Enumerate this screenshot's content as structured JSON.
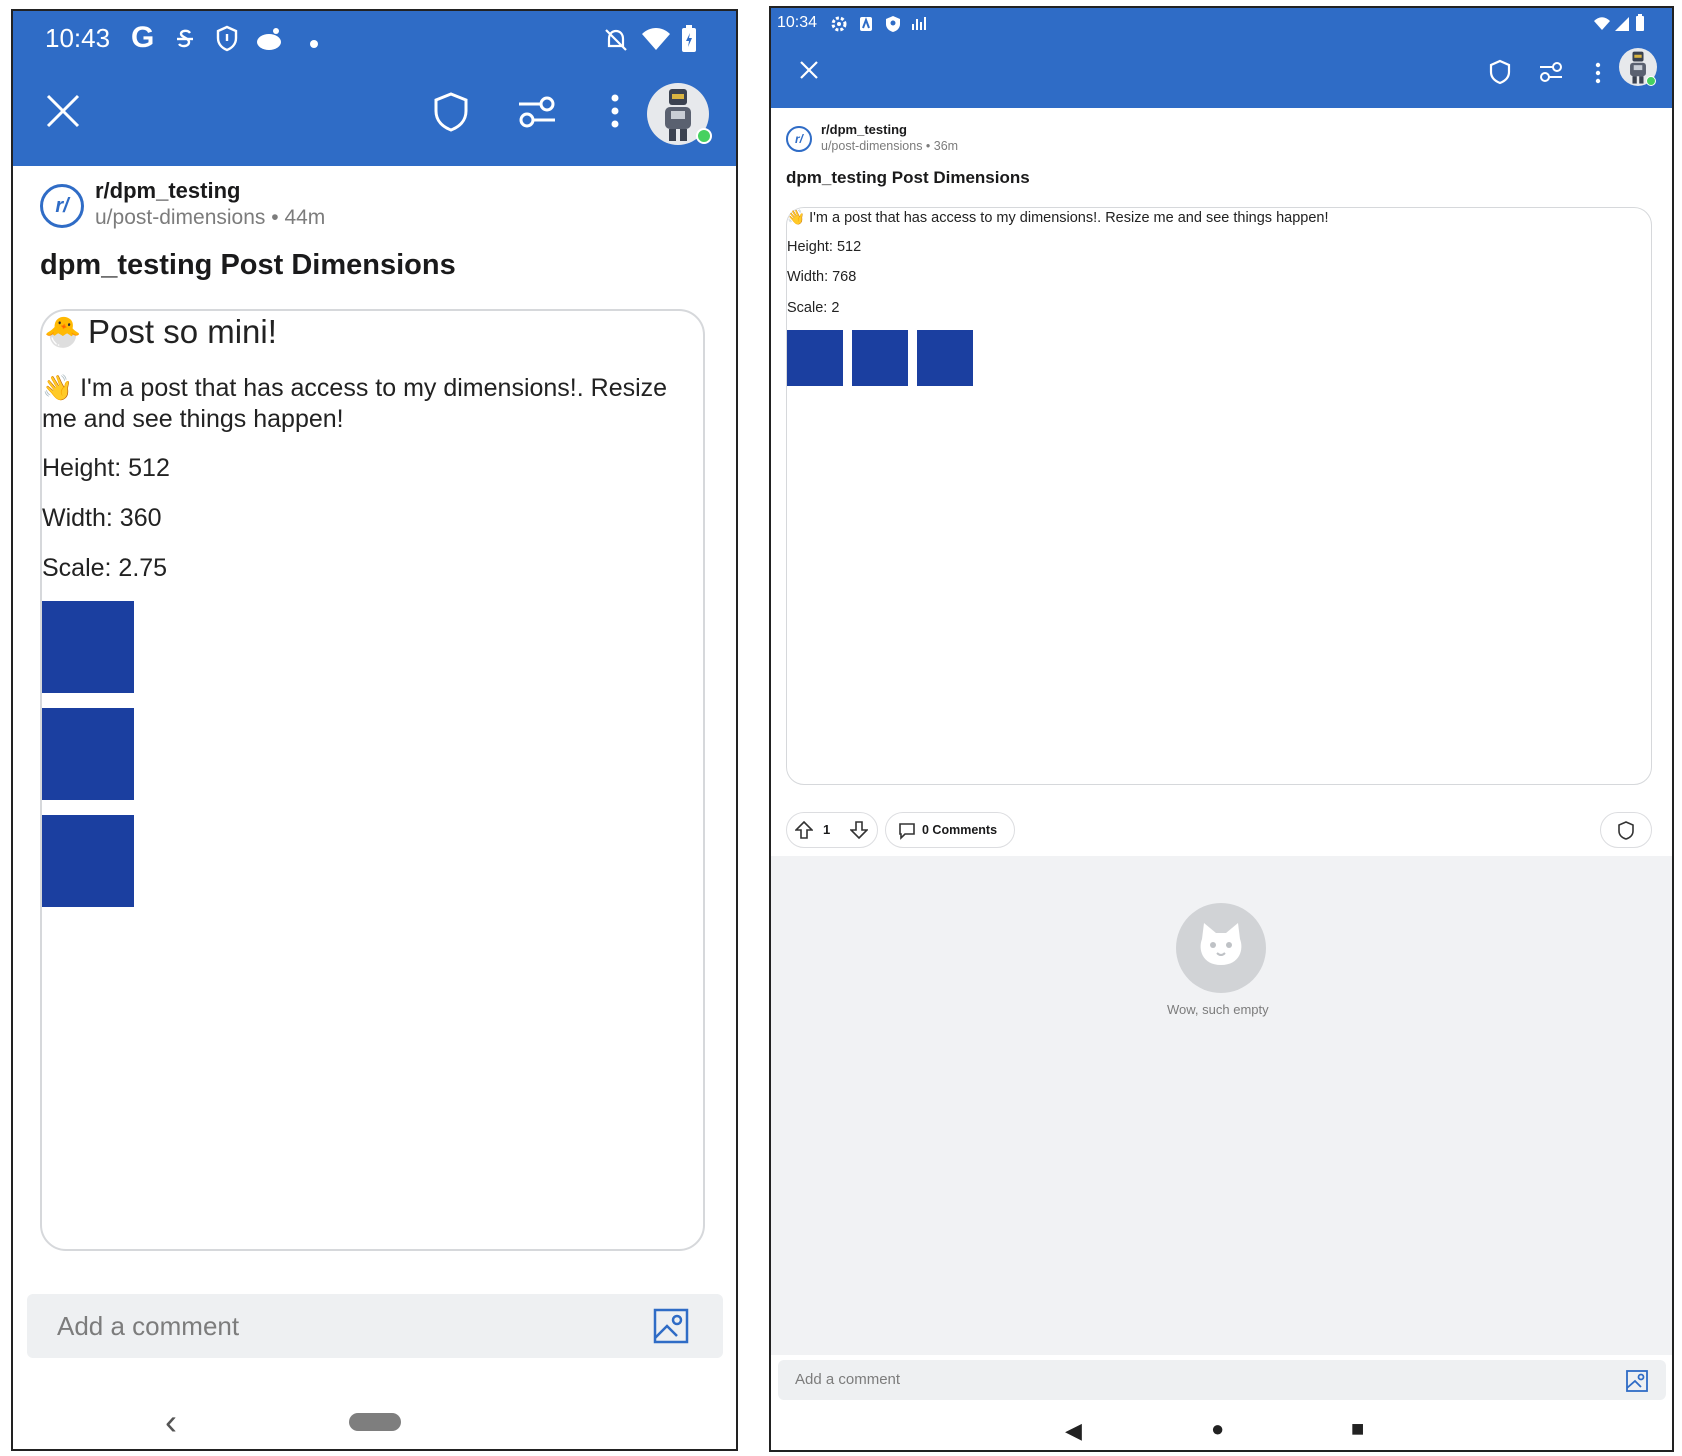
{
  "left": {
    "status": {
      "time": "10:43",
      "g_letter": "G"
    },
    "toolbar": {
      "close_icon": "close-icon",
      "mod_icon": "shield-icon",
      "filter_icon": "sliders-icon",
      "more_icon": "more-vertical-icon"
    },
    "post": {
      "subreddit": "r/dpm_testing",
      "author_line": "u/post-dimensions • 44m",
      "title": "dpm_testing Post Dimensions",
      "webview": {
        "heading_emoji": "🐣",
        "heading": "Post so mini!",
        "wave_emoji": "👋",
        "body": "I'm a post that has access to my dimensions!. Resize me and see things happen!",
        "height_label": "Height: 512",
        "width_label": "Width: 360",
        "scale_label": "Scale: 2.75",
        "block_count": 3,
        "block_color": "#1b3fa0"
      }
    },
    "comment": {
      "placeholder": "Add a comment"
    },
    "nav": {
      "back_glyph": "‹"
    }
  },
  "right": {
    "status": {
      "time": "10:34"
    },
    "post": {
      "subreddit": "r/dpm_testing",
      "author_line": "u/post-dimensions • 36m",
      "title": "dpm_testing Post Dimensions",
      "webview": {
        "wave_emoji": "👋",
        "body": "I'm a post that has access to my dimensions!. Resize me and see things happen!",
        "height_label": "Height: 512",
        "width_label": "Width: 768",
        "scale_label": "Scale: 2",
        "block_count": 3,
        "block_color": "#1b3fa0"
      }
    },
    "actions": {
      "vote_count": "1",
      "comments_label": "0 Comments"
    },
    "empty_state": {
      "text": "Wow, such empty"
    },
    "comment": {
      "placeholder": "Add a comment"
    },
    "nav": {
      "back": "◀",
      "home": "●",
      "recents": "■"
    }
  },
  "colors": {
    "brand_blue": "#2f6cc6",
    "block_blue": "#1b3fa0",
    "online_green": "#46d160"
  }
}
